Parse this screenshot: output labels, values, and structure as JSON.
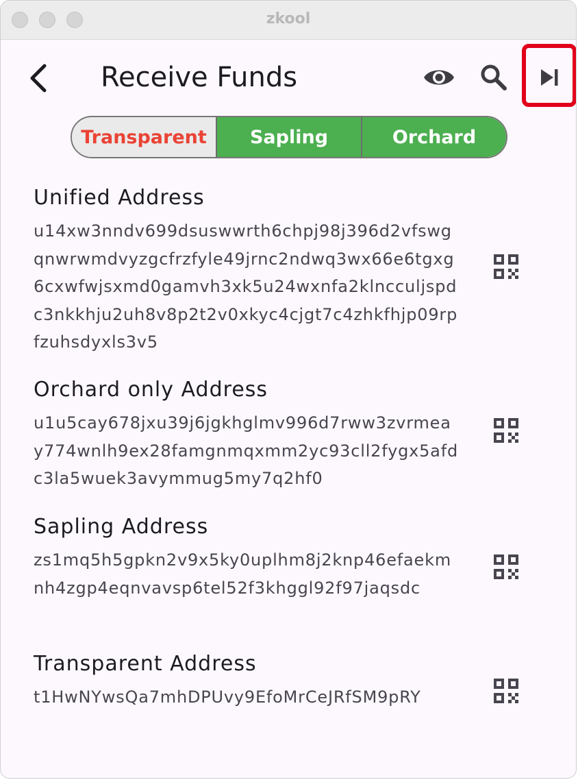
{
  "window": {
    "title": "zkool"
  },
  "appbar": {
    "title": "Receive Funds"
  },
  "tabs": [
    {
      "label": "Transparent",
      "selected": false
    },
    {
      "label": "Sapling",
      "selected": true
    },
    {
      "label": "Orchard",
      "selected": true
    }
  ],
  "addresses": [
    {
      "label": "Unified Address",
      "value": "u14xw3nndv699dsuswwrth6chpj98j396d2vfswgqnwrwmdvyzgcfrzfyle49jrnc2ndwq3wx66e6tgxg6cxwfwjsxmd0gamvh3xk5u24wxnfa2klncculjspdc3nkkhju2uh8v8p2t2v0xkyc4cjgt7c4zhkfhjp09rpfzuhsdyxls3v5"
    },
    {
      "label": "Orchard only Address",
      "value": "u1u5cay678jxu39j6jgkhglmv996d7rww3zvrmeay774wnlh9ex28famgnmqxmm2yc93cll2fygx5afdc3la5wuek3avymmug5my7q2hf0"
    },
    {
      "label": "Sapling Address",
      "value": "zs1mq5h5gpkn2v9x5ky0uplhm8j2knp46efaekmnh4zgp4eqnvavsp6tel52f3khggl92f97jaqsdc"
    },
    {
      "label": "Transparent Address",
      "value": "t1HwNYwsQa7mhDPUvy9EfoMrCeJRfSM9pRY"
    }
  ],
  "icons": {
    "back": "arrow-back-icon",
    "eye": "eye-icon",
    "search": "search-icon",
    "next": "skip-next-icon",
    "qr": "qr-code-icon"
  },
  "colors": {
    "selected_tab": "#4caf50",
    "unselected_tab_text": "#ea4335",
    "highlight_box": "#e1001a"
  }
}
